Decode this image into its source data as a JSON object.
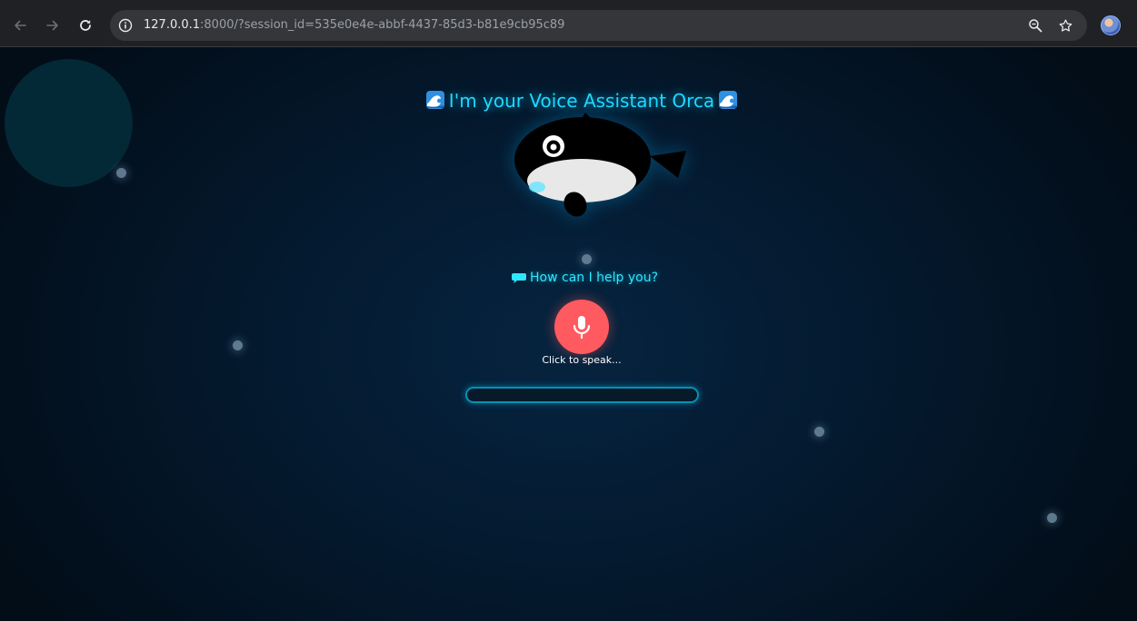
{
  "browser": {
    "url_host": "127.0.0.1",
    "url_path": ":8000/?session_id=535e0e4e-abbf-4437-85d3-b81e9cb95c89",
    "icons": {
      "back": "back-arrow-icon",
      "forward": "forward-arrow-icon",
      "reload": "reload-icon",
      "site_info": "site-info-icon",
      "zoom": "zoom-icon",
      "bookmark": "bookmark-star-icon",
      "profile": "profile-avatar"
    }
  },
  "app": {
    "title": "I'm your Voice Assistant Orca",
    "title_icon": "water-wave-emoji",
    "prompt": "How can I help you?",
    "prompt_icon": "speech-bubble-icon",
    "mic_label": "Click to speak...",
    "transcript_value": "",
    "colors": {
      "accent": "#20d8ff",
      "mic_button": "#ff5a5f",
      "background": "#04182c"
    }
  }
}
